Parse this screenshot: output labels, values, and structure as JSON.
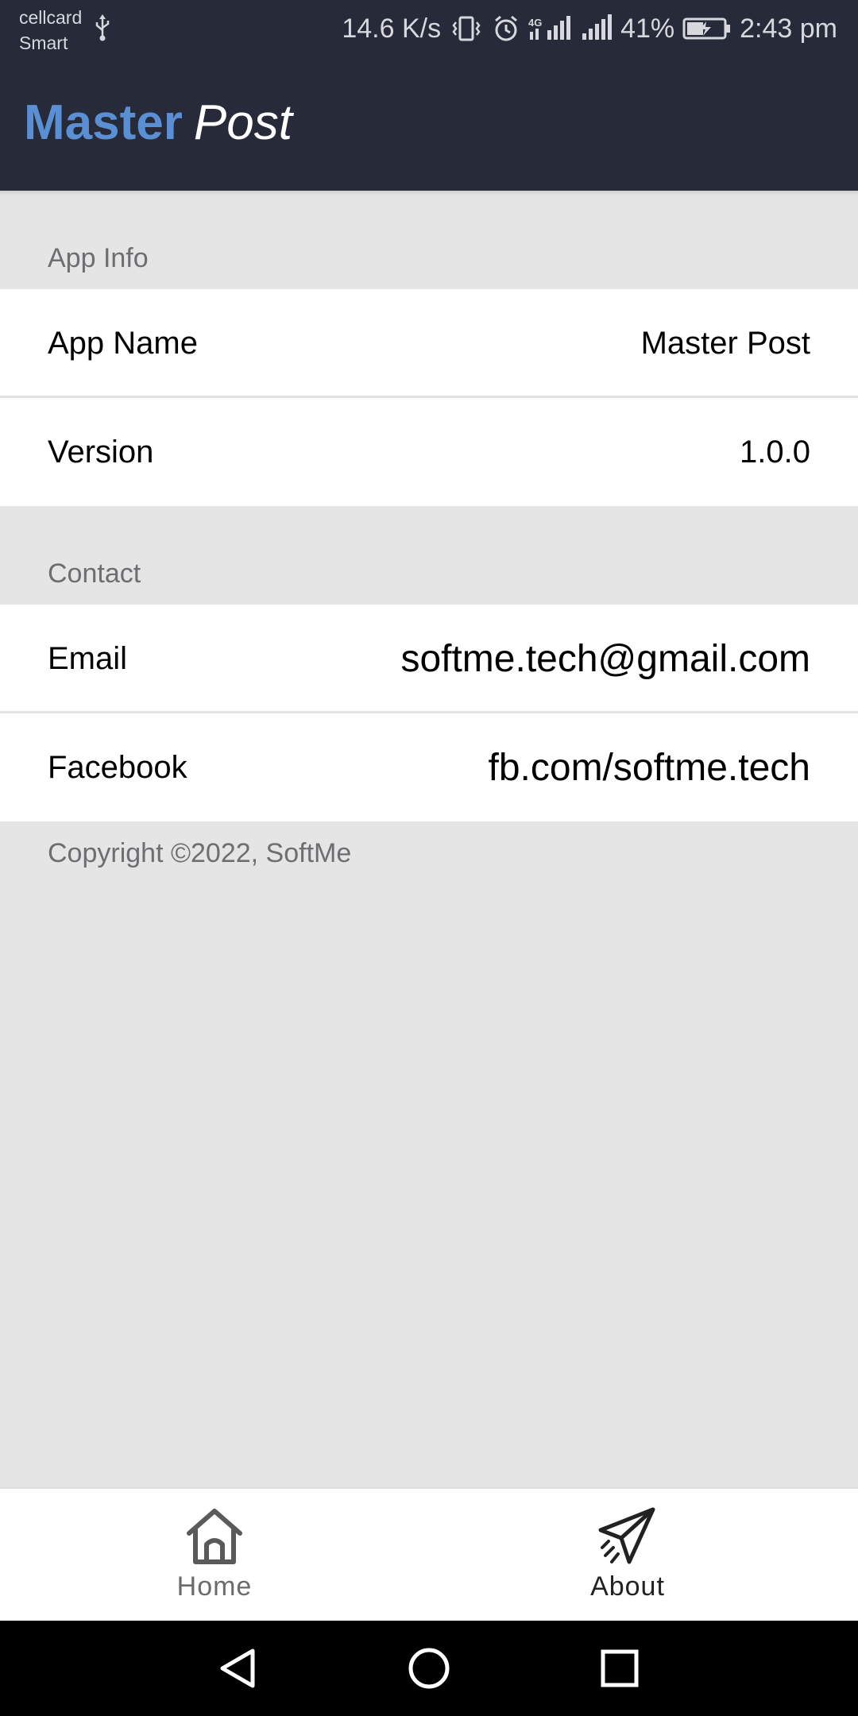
{
  "status_bar": {
    "carrier_line1": "cellcard",
    "carrier_line2": "Smart",
    "network_speed": "14.6 K/s",
    "battery_percent": "41%",
    "time": "2:43 pm",
    "icons": [
      "usb-icon",
      "vibrate-icon",
      "alarm-icon",
      "signal-4g-icon",
      "signal-icon",
      "battery-charging-icon"
    ]
  },
  "app_bar": {
    "title_part1": "Master",
    "title_part2": "Post",
    "accent_color": "#5b8fd4",
    "background_color": "#272b39"
  },
  "sections": {
    "app_info": {
      "header": "App Info",
      "rows": [
        {
          "label": "App Name",
          "value": "Master Post"
        },
        {
          "label": "Version",
          "value": "1.0.0"
        }
      ]
    },
    "contact": {
      "header": "Contact",
      "rows": [
        {
          "label": "Email",
          "value": "softme.tech@gmail.com"
        },
        {
          "label": "Facebook",
          "value": "fb.com/softme.tech"
        }
      ]
    }
  },
  "copyright": "Copyright ©2022, SoftMe",
  "bottom_nav": {
    "items": [
      {
        "label": "Home",
        "icon": "home-icon",
        "active": false
      },
      {
        "label": "About",
        "icon": "paper-plane-icon",
        "active": true
      }
    ]
  },
  "system_nav": {
    "icons": [
      "back-triangle-icon",
      "home-circle-icon",
      "recents-square-icon"
    ]
  }
}
